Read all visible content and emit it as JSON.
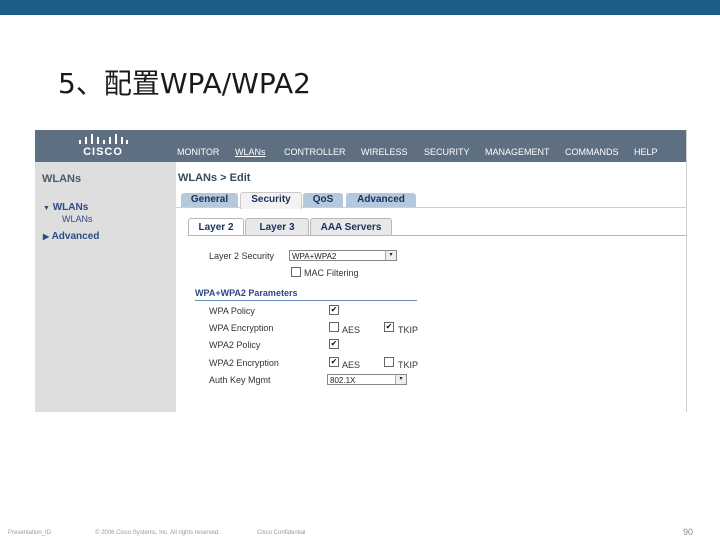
{
  "slide": {
    "title": "5、配置WPA/WPA2",
    "footer": {
      "presentation": "Presentation_ID",
      "copyright": "© 2006 Cisco Systems, Inc. All rights reserved.",
      "confidential": "Cisco Confidential",
      "page_number": "90"
    }
  },
  "app": {
    "logo_text": "CISCO",
    "menu": [
      "MONITOR",
      "WLANs",
      "CONTROLLER",
      "WIRELESS",
      "SECURITY",
      "MANAGEMENT",
      "COMMANDS",
      "HELP"
    ],
    "active_menu": "WLANs"
  },
  "left_nav": {
    "title": "WLANs",
    "items": [
      {
        "label": "WLANs",
        "expanded": true,
        "icon": "triangle-down-icon"
      },
      {
        "label": "WLANs",
        "sub": true
      },
      {
        "label": "Advanced",
        "expanded": false,
        "icon": "triangle-right-icon"
      }
    ]
  },
  "main": {
    "breadcrumb": "WLANs > Edit",
    "tabs": [
      "General",
      "Security",
      "QoS",
      "Advanced"
    ],
    "selected_tab": "Security",
    "subtabs": [
      "Layer 2",
      "Layer 3",
      "AAA Servers"
    ],
    "selected_subtab": "Layer 2",
    "layer2_security_label": "Layer 2 Security",
    "layer2_security_value": "WPA+WPA2",
    "mac_filtering_label": "MAC Filtering",
    "mac_filtering_checked": false,
    "params_title": "WPA+WPA2 Parameters",
    "wpa_policy_label": "WPA Policy",
    "wpa_policy_checked": true,
    "wpa_encryption_label": "WPA Encryption",
    "wpa_aes_label": "AES",
    "wpa_aes_checked": false,
    "wpa_tkip_label": "TKIP",
    "wpa_tkip_checked": true,
    "wpa2_policy_label": "WPA2 Policy",
    "wpa2_policy_checked": true,
    "wpa2_encryption_label": "WPA2 Encryption",
    "wpa2_aes_label": "AES",
    "wpa2_aes_checked": true,
    "wpa2_tkip_label": "TKIP",
    "wpa2_tkip_checked": false,
    "auth_key_label": "Auth Key Mgmt",
    "auth_key_value": "802.1X"
  },
  "colors": {
    "top_bar": "#1b5f86",
    "nav_bar": "#5d6f81",
    "tab": "#b5c9dd",
    "link": "#2c4a86"
  }
}
